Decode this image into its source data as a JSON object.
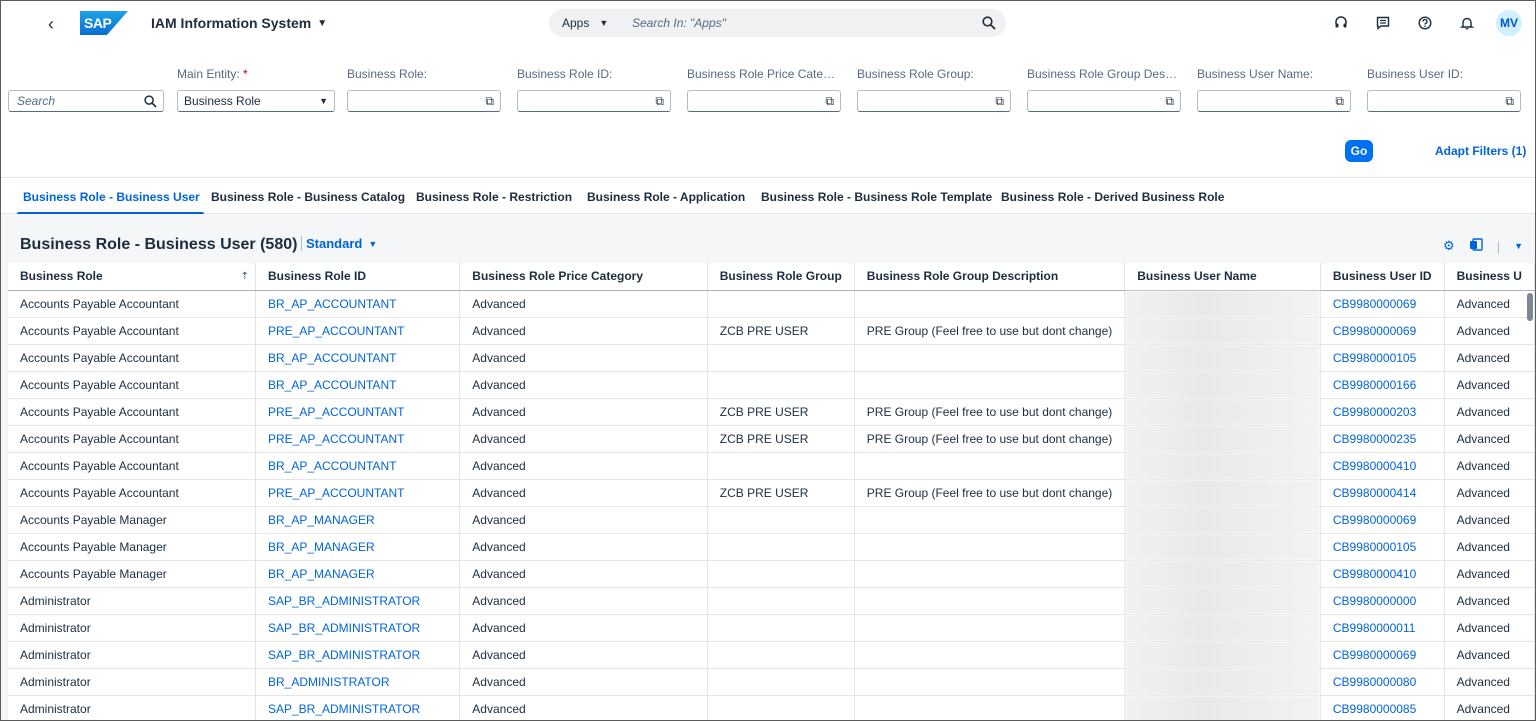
{
  "shell": {
    "back": "‹",
    "logo": "SAP",
    "title": "IAM Information System",
    "search_scope": "Apps",
    "search_placeholder": "Search In: \"Apps\"",
    "avatar": "MV"
  },
  "filters": {
    "basic_search_placeholder": "Search",
    "items": [
      {
        "label": "Main Entity:",
        "value": "Business Role"
      },
      {
        "label": "Business Role:",
        "value": ""
      },
      {
        "label": "Business Role ID:",
        "value": ""
      },
      {
        "label": "Business Role Price Category:",
        "value": ""
      },
      {
        "label": "Business Role Group:",
        "value": ""
      },
      {
        "label": "Business Role Group Descrip...",
        "value": ""
      },
      {
        "label": "Business User Name:",
        "value": ""
      },
      {
        "label": "Business User ID:",
        "value": ""
      }
    ],
    "go_label": "Go",
    "adapt_label": "Adapt Filters (1)"
  },
  "tabs": [
    "Business Role - Business User",
    "Business Role - Business Catalog",
    "Business Role - Restriction",
    "Business Role - Application",
    "Business Role - Business Role Template",
    "Business Role - Derived Business Role"
  ],
  "table": {
    "title": "Business Role - Business User (580)",
    "variant": "Standard",
    "columns": [
      "Business Role",
      "Business Role ID",
      "Business Role Price Category",
      "Business Role Group",
      "Business Role Group Description",
      "Business User Name",
      "Business User ID",
      "Business U"
    ],
    "rows": [
      [
        "Accounts Payable Accountant",
        "BR_AP_ACCOUNTANT",
        "Advanced",
        "",
        "",
        "",
        "CB9980000069",
        "Advanced"
      ],
      [
        "Accounts Payable Accountant",
        "PRE_AP_ACCOUNTANT",
        "Advanced",
        "ZCB PRE USER",
        "PRE Group (Feel free to use but dont change)",
        "",
        "CB9980000069",
        "Advanced"
      ],
      [
        "Accounts Payable Accountant",
        "BR_AP_ACCOUNTANT",
        "Advanced",
        "",
        "",
        "",
        "CB9980000105",
        "Advanced"
      ],
      [
        "Accounts Payable Accountant",
        "BR_AP_ACCOUNTANT",
        "Advanced",
        "",
        "",
        "",
        "CB9980000166",
        "Advanced"
      ],
      [
        "Accounts Payable Accountant",
        "PRE_AP_ACCOUNTANT",
        "Advanced",
        "ZCB PRE USER",
        "PRE Group (Feel free to use but dont change)",
        "",
        "CB9980000203",
        "Advanced"
      ],
      [
        "Accounts Payable Accountant",
        "PRE_AP_ACCOUNTANT",
        "Advanced",
        "ZCB PRE USER",
        "PRE Group (Feel free to use but dont change)",
        "",
        "CB9980000235",
        "Advanced"
      ],
      [
        "Accounts Payable Accountant",
        "BR_AP_ACCOUNTANT",
        "Advanced",
        "",
        "",
        "",
        "CB9980000410",
        "Advanced"
      ],
      [
        "Accounts Payable Accountant",
        "PRE_AP_ACCOUNTANT",
        "Advanced",
        "ZCB PRE USER",
        "PRE Group (Feel free to use but dont change)",
        "",
        "CB9980000414",
        "Advanced"
      ],
      [
        "Accounts Payable Manager",
        "BR_AP_MANAGER",
        "Advanced",
        "",
        "",
        "",
        "CB9980000069",
        "Advanced"
      ],
      [
        "Accounts Payable Manager",
        "BR_AP_MANAGER",
        "Advanced",
        "",
        "",
        "",
        "CB9980000105",
        "Advanced"
      ],
      [
        "Accounts Payable Manager",
        "BR_AP_MANAGER",
        "Advanced",
        "",
        "",
        "",
        "CB9980000410",
        "Advanced"
      ],
      [
        "Administrator",
        "SAP_BR_ADMINISTRATOR",
        "Advanced",
        "",
        "",
        "",
        "CB9980000000",
        "Advanced"
      ],
      [
        "Administrator",
        "SAP_BR_ADMINISTRATOR",
        "Advanced",
        "",
        "",
        "",
        "CB9980000011",
        "Advanced"
      ],
      [
        "Administrator",
        "SAP_BR_ADMINISTRATOR",
        "Advanced",
        "",
        "",
        "",
        "CB9980000069",
        "Advanced"
      ],
      [
        "Administrator",
        "BR_ADMINISTRATOR",
        "Advanced",
        "",
        "",
        "",
        "CB9980000080",
        "Advanced"
      ],
      [
        "Administrator",
        "SAP_BR_ADMINISTRATOR",
        "Advanced",
        "",
        "",
        "",
        "CB9980000085",
        "Advanced"
      ]
    ]
  },
  "colors": {
    "accent": "#0064d9",
    "go_button": "#0070f2",
    "required": "#aa0808"
  },
  "icons": [
    "back-icon",
    "chevron-down-icon",
    "search-icon",
    "headset-icon",
    "feedback-icon",
    "help-icon",
    "bell-icon",
    "value-help-icon",
    "sort-icon",
    "settings-icon",
    "export-icon"
  ]
}
